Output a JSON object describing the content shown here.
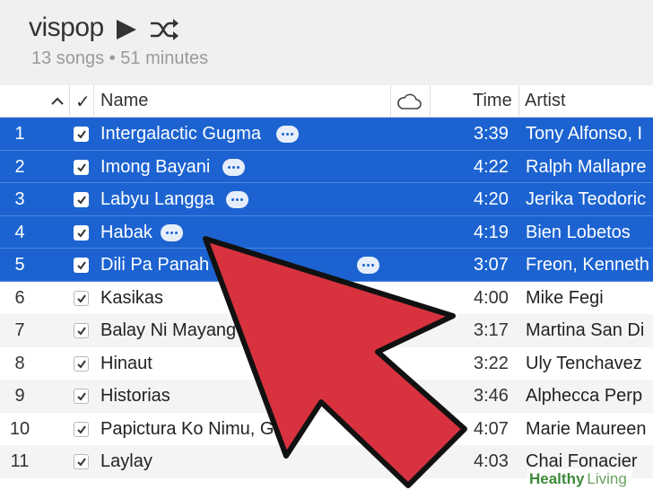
{
  "header": {
    "title": "vispop",
    "meta": "13 songs • 51 minutes",
    "play_icon": "play-icon",
    "shuffle_icon": "shuffle-icon"
  },
  "columns": {
    "sort_icon": "chevron-up-icon",
    "check": "✓",
    "name": "Name",
    "cloud_icon": "cloud-icon",
    "time": "Time",
    "artist": "Artist"
  },
  "tracks": [
    {
      "num": "1",
      "name": "Intergalactic Gugma",
      "time": "3:39",
      "artist": "Tony Alfonso, I",
      "selected": true
    },
    {
      "num": "2",
      "name": "Imong Bayani",
      "time": "4:22",
      "artist": "Ralph Mallapre",
      "selected": true
    },
    {
      "num": "3",
      "name": "Labyu Langga",
      "time": "4:20",
      "artist": "Jerika Teodoric",
      "selected": true
    },
    {
      "num": "4",
      "name": "Habak",
      "time": "4:19",
      "artist": "Bien Lobetos",
      "selected": true
    },
    {
      "num": "5",
      "name": "Dili Pa Panah    Kann...",
      "time": "3:07",
      "artist": "Freon, Kenneth",
      "selected": true
    },
    {
      "num": "6",
      "name": "Kasikas",
      "time": "4:00",
      "artist": "Mike Fegi",
      "selected": false
    },
    {
      "num": "7",
      "name": "Balay Ni Mayang",
      "time": "3:17",
      "artist": "Martina San Di",
      "selected": false
    },
    {
      "num": "8",
      "name": "Hinaut",
      "time": "3:22",
      "artist": "Uly Tenchavez",
      "selected": false
    },
    {
      "num": "9",
      "name": "Historias",
      "time": "3:46",
      "artist": "Alphecca Perp",
      "selected": false
    },
    {
      "num": "10",
      "name": "Papictura Ko Nimu, Gw",
      "time": "4:07",
      "artist": "Marie Maureen",
      "selected": false
    },
    {
      "num": "11",
      "name": "Laylay",
      "time": "4:03",
      "artist": "Chai Fonacier",
      "selected": false
    }
  ],
  "more_positions": [
    308,
    248,
    252,
    179,
    398
  ],
  "colors": {
    "selection": "#1c63d1",
    "arrow_fill": "#d8323f",
    "arrow_stroke": "#111111"
  },
  "watermark": {
    "first": "Healthy",
    "second": "Living"
  }
}
